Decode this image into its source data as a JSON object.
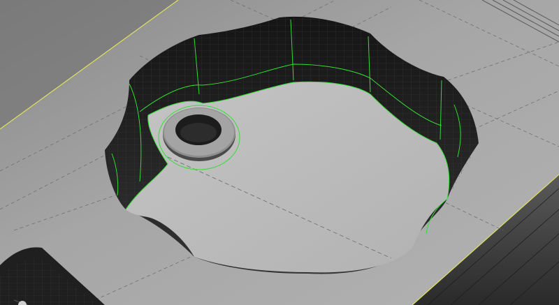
{
  "viewport": {
    "view_mode": "shaded-with-edges",
    "background_color": "#202020"
  },
  "model": {
    "part": "plate-with-scalloped-pocket",
    "pocket_lobes": 8,
    "features": [
      "scalloped-pocket",
      "counterbore-hole",
      "partial-pocket-corner"
    ],
    "colors": {
      "top_face": "#a7a7a7",
      "floor_face": "#bcbcbc",
      "wall_face": "#1e1e1e",
      "edge_highlight": "#33dd33",
      "selected_edge": "#e0e060",
      "construction_line": "#7a7a7a"
    }
  }
}
